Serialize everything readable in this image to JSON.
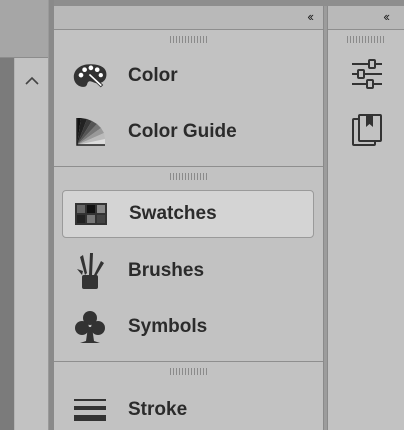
{
  "panels": {
    "group1": [
      {
        "label": "Color",
        "icon": "palette-icon"
      },
      {
        "label": "Color Guide",
        "icon": "color-guide-icon"
      }
    ],
    "group2": [
      {
        "label": "Swatches",
        "icon": "swatches-grid-icon",
        "selected": true
      },
      {
        "label": "Brushes",
        "icon": "brushes-icon"
      },
      {
        "label": "Symbols",
        "icon": "club-icon"
      }
    ],
    "group3": [
      {
        "label": "Stroke",
        "icon": "stroke-lines-icon"
      }
    ]
  },
  "header": {
    "collapse_left": "‹‹",
    "collapse_right": "‹‹"
  },
  "right_column": {
    "buttons": [
      "sliders-icon",
      "book-copy-icon"
    ]
  },
  "scroll": {
    "up_glyph": "^"
  }
}
